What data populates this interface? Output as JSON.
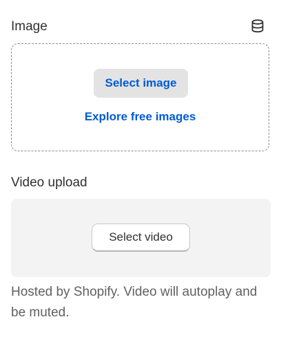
{
  "image_field": {
    "label": "Image",
    "icon": "database-icon",
    "select_button": "Select image",
    "explore_link": "Explore free images"
  },
  "video_field": {
    "label": "Video upload",
    "select_button": "Select video",
    "help_text": "Hosted by Shopify. Video will autoplay and be muted."
  },
  "colors": {
    "link": "#005bd3",
    "text": "#303030",
    "muted_text": "#616161",
    "button_gray": "#e3e3e3",
    "panel_bg": "#f3f3f3"
  }
}
